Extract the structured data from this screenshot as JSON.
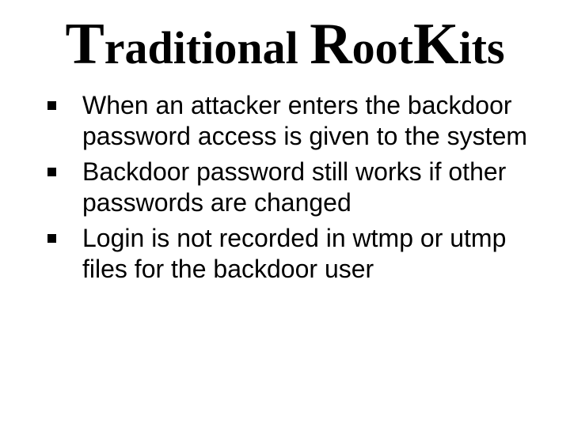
{
  "title": {
    "w1": {
      "cap": "T",
      "rest": "raditional"
    },
    "w2": {
      "cap": "R",
      "rest": "oot"
    },
    "w3": {
      "cap": "K",
      "rest": "its"
    }
  },
  "bullets": [
    "When an attacker enters the backdoor password access is given to the system",
    "Backdoor password still works if other passwords are changed",
    "Login is not recorded in wtmp or utmp files for the backdoor user"
  ]
}
